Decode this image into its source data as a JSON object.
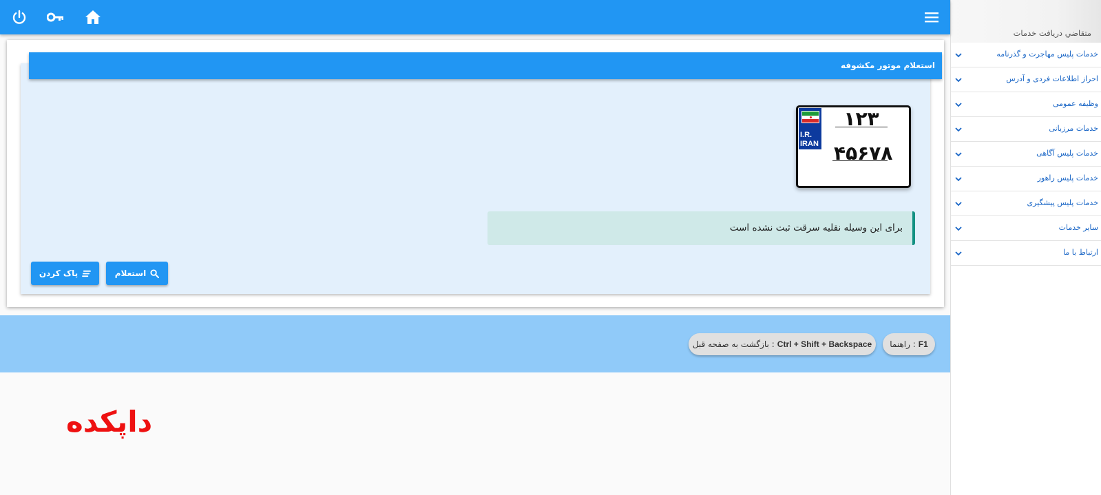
{
  "colors": {
    "primary": "#2196f3",
    "panel_bg": "#e3f0fc",
    "band_bg": "#90caf9",
    "alert_bg": "#cfe9e8",
    "alert_border": "#149183",
    "link_blue": "#1a66c6",
    "watermark_red": "#ee1111"
  },
  "topbar": {
    "icons": [
      "power-icon",
      "key-icon",
      "home-icon",
      "menu-icon"
    ]
  },
  "sidebar": {
    "welcome": "متقاضي دريافت خدمات",
    "items": [
      {
        "label": "خدمات پلیس مهاجرت و گذرنامه",
        "icon": "chevron-down-icon"
      },
      {
        "label": "احراز اطلاعات فردی و آدرس",
        "icon": "chevron-down-icon"
      },
      {
        "label": "وظیفه عمومی",
        "icon": "chevron-down-icon"
      },
      {
        "label": "خدمات مرزبانی",
        "icon": "chevron-down-icon"
      },
      {
        "label": "خدمات پلیس آگاهی",
        "icon": "chevron-down-icon"
      },
      {
        "label": "خدمات پلیس راهور",
        "icon": "chevron-down-icon"
      },
      {
        "label": "خدمات پلیس پیشگیری",
        "icon": "chevron-down-icon"
      },
      {
        "label": "سایر خدمات",
        "icon": "chevron-down-icon"
      },
      {
        "label": "ارتباط با ما",
        "icon": "chevron-down-icon"
      }
    ]
  },
  "panel": {
    "title": "استعلام موتور مکشوفه"
  },
  "plate": {
    "top_number": "۱۲۳",
    "bottom_number": "۴۵۶۷۸",
    "country_line1": "I.R.",
    "country_line2": "IRAN"
  },
  "alert": {
    "text": "برای این وسیله نقلیه سرقت ثبت نشده است"
  },
  "buttons": {
    "search_label": "استعلام",
    "clear_label": "پاک کردن"
  },
  "shortcuts": {
    "help_key": "F1",
    "help_text": ": راهنما",
    "back_key": "Ctrl + Shift + Backspace",
    "back_text": ": بازگشت به صفحه قبل"
  },
  "watermark": "داپکده"
}
